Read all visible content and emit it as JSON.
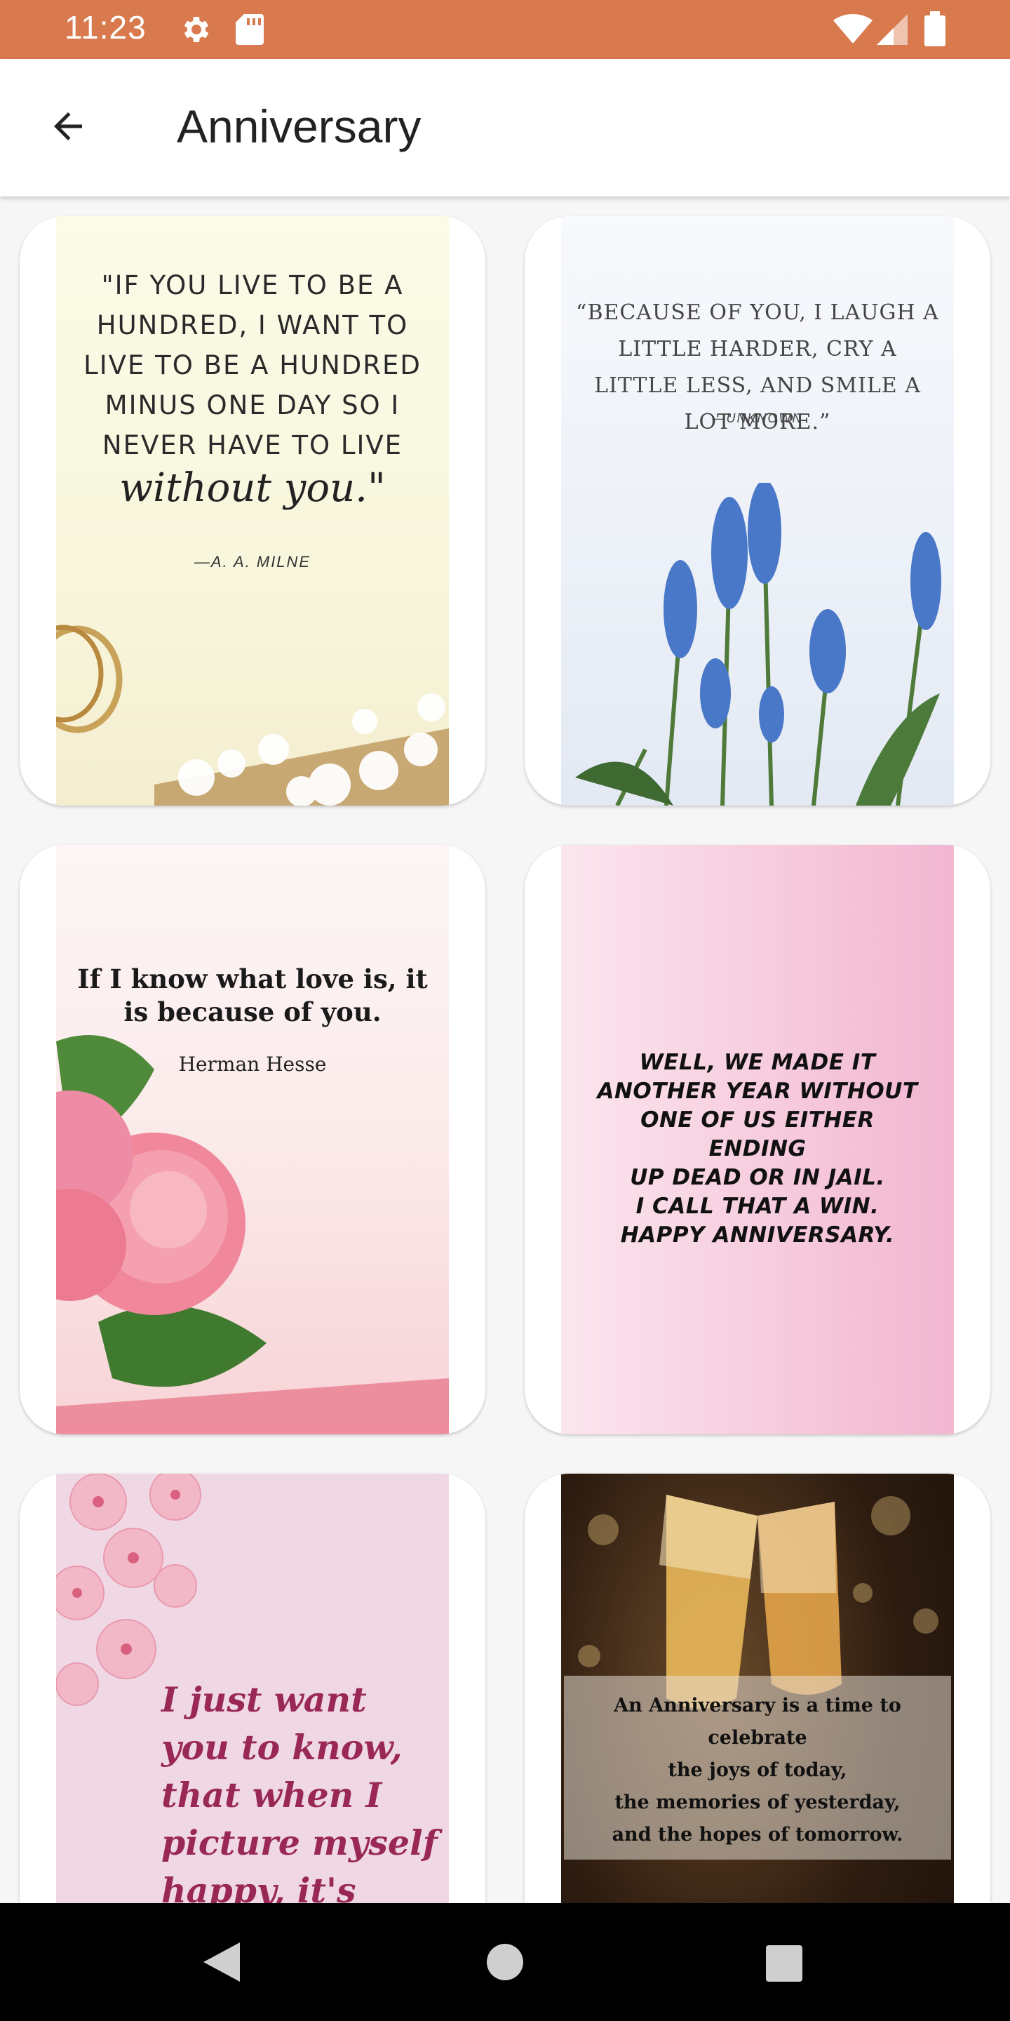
{
  "status_bar": {
    "time": "11:23",
    "icons": [
      "gear-icon",
      "sd-card-icon",
      "wifi-icon",
      "signal-icon",
      "battery-icon"
    ],
    "color": "#d97a4e"
  },
  "app_bar": {
    "title": "Anniversary",
    "back_icon": "arrow-left-icon"
  },
  "cards": [
    {
      "quote_lines": [
        "\"IF YOU LIVE TO BE A",
        "HUNDRED, I WANT TO",
        "LIVE TO BE A HUNDRED",
        "MINUS ONE DAY SO I",
        "NEVER HAVE TO LIVE"
      ],
      "script": "without you.\"",
      "author": "—A. A. MILNE"
    },
    {
      "quote": "“BECAUSE OF YOU, I LAUGH A LITTLE HARDER, CRY A LITTLE LESS, AND SMILE A LOT MORE.”",
      "author": "—UNKNOWN"
    },
    {
      "quote": "If I know what love is, it is because of you.",
      "author": "Herman Hesse"
    },
    {
      "quote_lines": [
        "WELL, WE MADE IT",
        "ANOTHER YEAR WITHOUT",
        "ONE OF US EITHER ENDING",
        "UP DEAD OR IN JAIL.",
        "I CALL THAT A WIN.",
        "HAPPY ANNIVERSARY."
      ]
    },
    {
      "quote_lines": [
        "I just want",
        "you to know,",
        "that when I",
        "picture myself",
        "happy, it's"
      ]
    },
    {
      "quote_lines": [
        "An Anniversary is a time to celebrate",
        "the  joys of today,",
        "the memories of yesterday,",
        "and the hopes of tomorrow."
      ]
    }
  ],
  "nav_bar": {
    "icons": [
      "back-triangle-icon",
      "home-circle-icon",
      "recents-square-icon"
    ]
  }
}
